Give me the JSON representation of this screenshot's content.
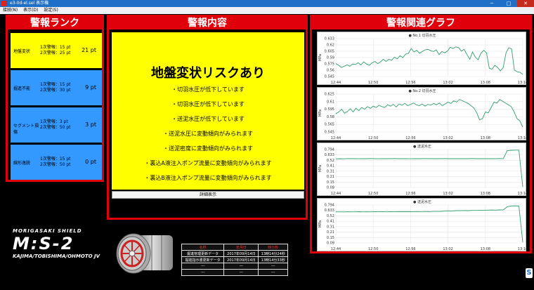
{
  "window": {
    "title": "e3-0d-el.sel 表示機",
    "minimize": "─",
    "maximize": "□",
    "close": "✕"
  },
  "menu": [
    "接続(N)",
    "表示(D)",
    "設定(S)"
  ],
  "rank_panel": {
    "title": "警報ランク",
    "items": [
      {
        "name": "地盤変状",
        "cond1": "1次警報：15 pt",
        "cond2": "2次警報：25 pt",
        "pt": "21 pt",
        "color": "#ffff00"
      },
      {
        "name": "掘進不能",
        "cond1": "1次警報：15 pt",
        "cond2": "2次警報：30 pt",
        "pt": "9 pt",
        "color": "#3399ff"
      },
      {
        "name": "セグメント損傷",
        "cond1": "1次警報：3 pt",
        "cond2": "2次警報：50 pt",
        "pt": "3 pt",
        "color": "#3399ff"
      },
      {
        "name": "線形逸脱",
        "cond1": "1次警報：15 pt",
        "cond2": "2次警報：50 pt",
        "pt": "0 pt",
        "color": "#3399ff"
      }
    ]
  },
  "message_panel": {
    "title": "警報内容",
    "heading": "地盤変状リスクあり",
    "lines": [
      "・切羽水圧が低下しています",
      "・切羽水圧が低下しています",
      "・送泥水圧が低下しています",
      "・送泥水圧に変動傾向がみられます",
      "・送泥密度に変動傾向がみられます",
      "・裏込A液注入ポンプ流量に変動傾向がみられます",
      "・裏込B液注入ポンプ流量に変動傾向がみられます"
    ],
    "detail_button": "詳細表示"
  },
  "graph_panel": {
    "title": "警報関連グラフ"
  },
  "chart_data": [
    {
      "type": "line",
      "legend": "No.1 切羽水圧",
      "ylabel": "MPa",
      "ylim": [
        0.545,
        0.633
      ],
      "yticks": [
        "0.633",
        "0.62",
        "0.605",
        "0.59",
        "0.575",
        "0.56",
        "0.545"
      ],
      "xticks": [
        "12:44",
        "12:50",
        "12:56",
        "13:02",
        "13:08",
        "13:14"
      ],
      "series": [
        {
          "values": [
            0.575,
            0.571,
            0.566,
            0.569,
            0.572,
            0.569,
            0.574,
            0.573,
            0.577,
            0.572,
            0.579,
            0.574,
            0.571,
            0.577,
            0.58,
            0.575,
            0.579,
            0.585,
            0.58,
            0.585,
            0.583,
            0.59,
            0.586,
            0.593,
            0.589,
            0.597,
            0.599,
            0.61,
            0.602,
            0.606,
            0.599,
            0.603,
            0.607,
            0.608,
            0.605,
            0.603,
            0.607,
            0.596,
            0.603,
            0.6,
            0.604,
            0.613,
            0.61,
            0.614,
            0.612,
            0.604,
            0.608,
            0.596,
            0.585,
            0.602,
            0.59,
            0.584,
            0.599,
            0.606,
            0.6,
            0.564,
            0.562,
            0.571,
            0.566,
            0.558,
            0.566,
            0.6,
            0.612,
            0.609,
            0.56,
            0.556,
            0.555,
            0.55
          ]
        }
      ]
    },
    {
      "type": "line",
      "legend": "No.2 切羽水圧",
      "ylabel": "MPa",
      "ylim": [
        0.545,
        0.63
      ],
      "yticks": [
        "0.625",
        "0.61",
        "0.595",
        "0.58",
        "0.565",
        "0.545"
      ],
      "xticks": [
        "12:44",
        "12:50",
        "12:56",
        "13:02",
        "13:08",
        "13:14"
      ],
      "series": [
        {
          "values": [
            0.586,
            0.59,
            0.596,
            0.587,
            0.591,
            0.597,
            0.59,
            0.598,
            0.593,
            0.6,
            0.596,
            0.602,
            0.598,
            0.603,
            0.6,
            0.605,
            0.602,
            0.6,
            0.606,
            0.603,
            0.607,
            0.601,
            0.608,
            0.605,
            0.609,
            0.604,
            0.607,
            0.61,
            0.606,
            0.604,
            0.608,
            0.603,
            0.607,
            0.605,
            0.609,
            0.606,
            0.61,
            0.604,
            0.608,
            0.612,
            0.609,
            0.615,
            0.612,
            0.618,
            0.615,
            0.612,
            0.609,
            0.604,
            0.599,
            0.588,
            0.572,
            0.575,
            0.59,
            0.588,
            0.6,
            0.612,
            0.61,
            0.618,
            0.614,
            0.61,
            0.606,
            0.602,
            0.59,
            0.575,
            0.57,
            0.556
          ]
        }
      ]
    },
    {
      "type": "line",
      "legend": "送泥水圧",
      "ylabel": "MPa",
      "ylim": [
        0.09,
        0.794
      ],
      "yticks": [
        "0.794",
        "0.633",
        "0.52",
        "0.41",
        "0.31",
        "0.21",
        "0.15",
        "0.09"
      ],
      "xticks": [
        "12:44",
        "12:50",
        "12:56",
        "13:02",
        "13:08",
        "13:14"
      ],
      "series": [
        {
          "values": [
            0.62,
            0.625,
            0.622,
            0.627,
            0.624,
            0.626,
            0.623,
            0.625,
            0.624,
            0.627,
            0.625,
            0.623,
            0.626,
            0.624,
            0.625,
            0.627,
            0.624,
            0.626,
            0.625,
            0.623,
            0.626,
            0.625,
            0.624,
            0.627,
            0.625,
            0.626,
            0.624,
            0.625,
            0.627,
            0.624,
            0.626,
            0.625,
            0.624,
            0.626,
            0.625,
            0.627,
            0.624,
            0.626,
            0.625,
            0.624,
            0.626,
            0.625,
            0.627,
            0.626,
            0.772,
            0.781,
            0.783,
            0.784,
            0.1
          ]
        }
      ]
    },
    {
      "type": "line",
      "legend": "送泥水圧",
      "ylabel": "MPa",
      "ylim": [
        0.09,
        0.794
      ],
      "yticks": [
        "0.794",
        "0.633",
        "0.52",
        "0.41",
        "0.31",
        "0.21",
        "0.15",
        "0.09"
      ],
      "xticks": [
        "12:44",
        "12:50",
        "12:56",
        "13:02",
        "13:08",
        "13:14"
      ],
      "series": [
        {
          "values": [
            0.667,
            0.668,
            0.666,
            0.669,
            0.667,
            0.668,
            0.67,
            0.667,
            0.669,
            0.668,
            0.67,
            0.669,
            0.671,
            0.668,
            0.67,
            0.669,
            0.671,
            0.67,
            0.672,
            0.67,
            0.671,
            0.673,
            0.672,
            0.674,
            0.672,
            0.675,
            0.676,
            0.677,
            0.68,
            0.684,
            0.686,
            0.69,
            0.688,
            0.692,
            0.69,
            0.694,
            0.693,
            0.695,
            0.697,
            0.699,
            0.701,
            0.7,
            0.703,
            0.705,
            0.76,
            0.777,
            0.778,
            0.777,
            0.1
          ]
        }
      ]
    }
  ],
  "logo": {
    "top": "MORIGASAKI SHIELD",
    "main": "M:S-2",
    "bottom": "KAJIMA/TOBISHIMA/OHMOTO JV"
  },
  "history": {
    "headers": [
      "名称",
      "年月日",
      "時分秒"
    ],
    "rows": [
      [
        "掘進管理更新データ",
        "2017年09月14日",
        "13時14分24秒"
      ],
      [
        "掘進指示書更新データ",
        "2017年09月14日",
        "13時14分33秒"
      ],
      [
        "---",
        "---",
        "---"
      ],
      [
        "---",
        "---",
        "---"
      ]
    ]
  },
  "side_icon": "S",
  "colors": {
    "frame": "#e0000c",
    "line": "#2f9e6a",
    "yellow": "#ffff00",
    "blue": "#3399ff"
  }
}
